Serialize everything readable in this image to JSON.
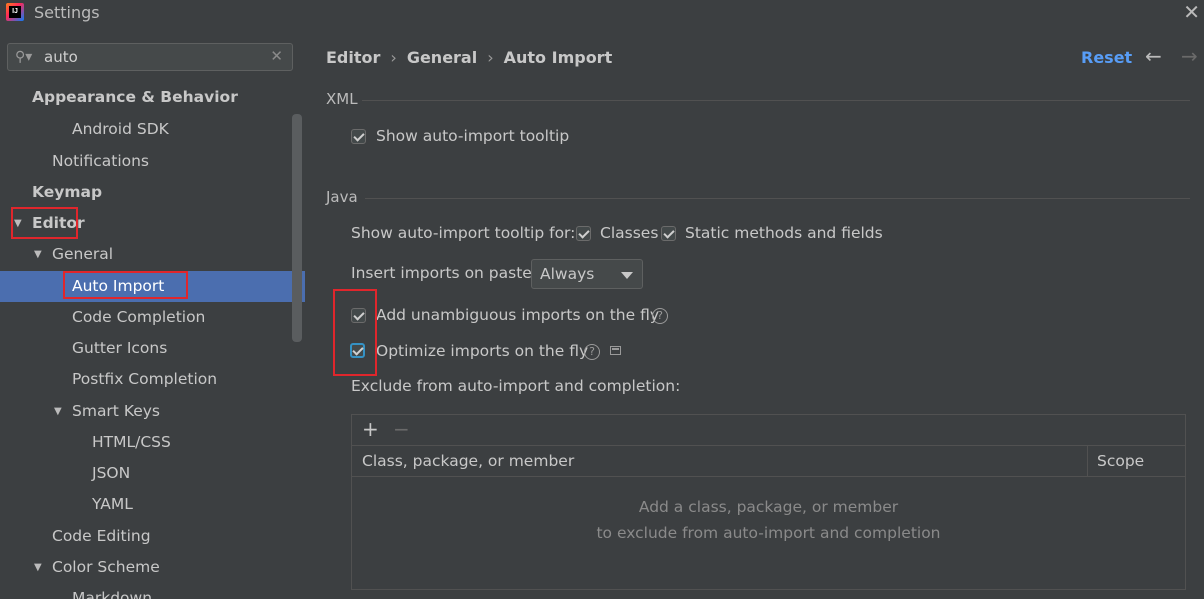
{
  "window": {
    "title": "Settings"
  },
  "search": {
    "value": "auto"
  },
  "sidebar": {
    "items": [
      {
        "label": "Appearance & Behavior"
      },
      {
        "label": "Android SDK"
      },
      {
        "label": "Notifications"
      },
      {
        "label": "Keymap"
      },
      {
        "label": "Editor"
      },
      {
        "label": "General"
      },
      {
        "label": "Auto Import"
      },
      {
        "label": "Code Completion"
      },
      {
        "label": "Gutter Icons"
      },
      {
        "label": "Postfix Completion"
      },
      {
        "label": "Smart Keys"
      },
      {
        "label": "HTML/CSS"
      },
      {
        "label": "JSON"
      },
      {
        "label": "YAML"
      },
      {
        "label": "Code Editing"
      },
      {
        "label": "Color Scheme"
      },
      {
        "label": "Markdown"
      }
    ]
  },
  "breadcrumb": {
    "items": [
      "Editor",
      "General",
      "Auto Import"
    ]
  },
  "header": {
    "reset_label": "Reset"
  },
  "xml": {
    "section_title": "XML",
    "show_tooltip": {
      "label": "Show auto-import tooltip",
      "checked": true
    }
  },
  "java": {
    "section_title": "Java",
    "tooltip_for_label": "Show auto-import tooltip for:",
    "classes": {
      "label": "Classes",
      "checked": true
    },
    "static_methods": {
      "label": "Static methods and fields",
      "checked": true
    },
    "insert_on_paste_label": "Insert imports on paste:",
    "insert_on_paste_value": "Always",
    "add_unambiguous": {
      "label": "Add unambiguous imports on the fly",
      "checked": true
    },
    "optimize_imports": {
      "label": "Optimize imports on the fly",
      "checked": true
    },
    "exclude_label": "Exclude from auto-import and completion:"
  },
  "exclude_table": {
    "columns": [
      "Class, package, or member",
      "Scope"
    ],
    "empty_line1": "Add a class, package, or member",
    "empty_line2": "to exclude from auto-import and completion"
  },
  "colors": {
    "accent": "#4b6eaf",
    "link": "#589df6",
    "highlight": "#e0262c"
  }
}
